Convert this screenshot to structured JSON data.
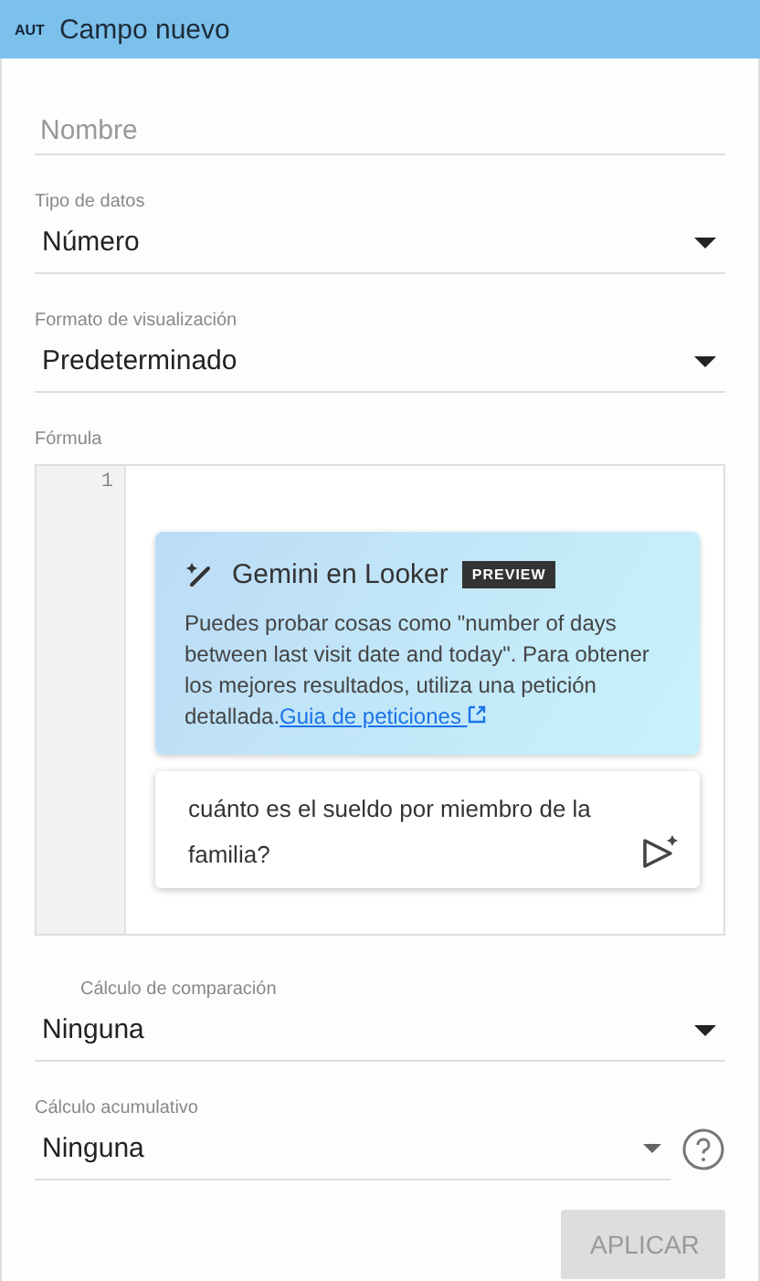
{
  "header": {
    "badge": "AUT",
    "title": "Campo nuevo"
  },
  "name_field": {
    "placeholder": "Nombre"
  },
  "data_type": {
    "label": "Tipo de datos",
    "value": "Número"
  },
  "display_format": {
    "label": "Formato de visualización",
    "value": "Predeterminado"
  },
  "formula": {
    "label": "Fórmula",
    "line_numbers": [
      "1"
    ],
    "gemini": {
      "title": "Gemini en Looker",
      "badge": "PREVIEW",
      "text": "Puedes probar cosas como \"number of days between last visit date and today\". Para obtener los mejores resultados, utiliza una petición detallada.",
      "link": "Guia de peticiones"
    },
    "prompt": {
      "value": "cuánto es el sueldo por miembro de la familia?"
    }
  },
  "comparison": {
    "label": "Cálculo de comparación",
    "value": "Ninguna"
  },
  "cumulative": {
    "label": "Cálculo acumulativo",
    "value": "Ninguna"
  },
  "apply_button": {
    "label": "APLICAR",
    "disabled": true
  }
}
